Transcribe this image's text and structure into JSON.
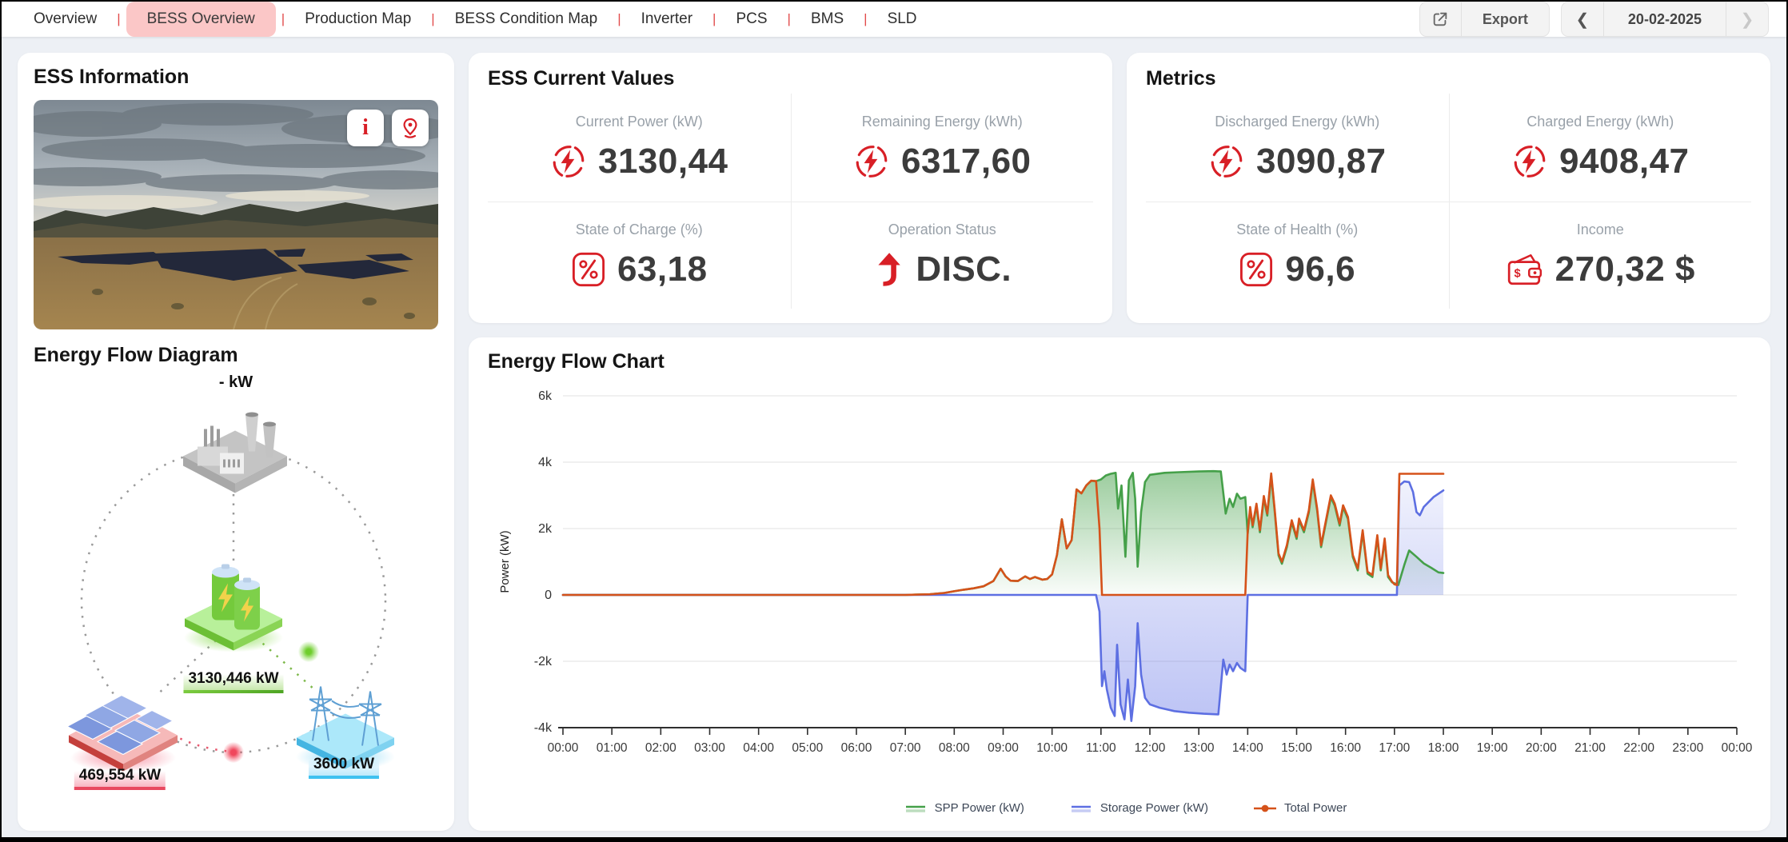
{
  "nav": {
    "tabs": [
      {
        "label": "Overview",
        "active": false
      },
      {
        "label": "BESS Overview",
        "active": true
      },
      {
        "label": "Production Map",
        "active": false
      },
      {
        "label": "BESS Condition Map",
        "active": false
      },
      {
        "label": "Inverter",
        "active": false
      },
      {
        "label": "PCS",
        "active": false
      },
      {
        "label": "BMS",
        "active": false
      },
      {
        "label": "SLD",
        "active": false
      }
    ],
    "separator": "|",
    "export_label": "Export",
    "date_value": "20-02-2025",
    "prev_icon": "chevron-left",
    "next_icon": "chevron-right"
  },
  "ess_information": {
    "title": "ESS Information",
    "photo_buttons": [
      {
        "name": "info"
      },
      {
        "name": "location"
      }
    ]
  },
  "energy_flow_diagram": {
    "title": "Energy Flow Diagram",
    "grid_power_label": "- kW",
    "battery_power_label": "3130,446 kW",
    "spp_power_label": "469,554 kW",
    "grid_export_label": "3600 kW"
  },
  "ess_current_values": {
    "title": "ESS Current Values",
    "stats": [
      {
        "label": "Current Power (kW)",
        "value": "3130,44",
        "icon": "bolt-circle"
      },
      {
        "label": "Remaining Energy (kWh)",
        "value": "6317,60",
        "icon": "bolt-circle"
      },
      {
        "label": "State of Charge (%)",
        "value": "63,18",
        "icon": "percent-box"
      },
      {
        "label": "Operation Status",
        "value": "DISC.",
        "icon": "discharge-arrow"
      }
    ]
  },
  "metrics": {
    "title": "Metrics",
    "stats": [
      {
        "label": "Discharged Energy (kWh)",
        "value": "3090,87",
        "icon": "bolt-circle"
      },
      {
        "label": "Charged Energy (kWh)",
        "value": "9408,47",
        "icon": "bolt-circle"
      },
      {
        "label": "State of Health (%)",
        "value": "96,6",
        "icon": "percent-box"
      },
      {
        "label": "Income",
        "value": "270,32 $",
        "icon": "wallet"
      }
    ]
  },
  "colors": {
    "accent_red": "#d81f26",
    "nav_active_pink": "#fbc7c7",
    "spp_green": "#45a049",
    "storage_blue": "#5d6fe2",
    "total_orange": "#d5521a",
    "grid_gray": "#e9e9e9",
    "page_bg": "#edf0f5"
  },
  "chart_data": {
    "type": "line",
    "title": "Energy Flow Chart",
    "ylabel": "Power (kW)",
    "xlabel": "",
    "ylim": [
      -4000,
      6000
    ],
    "yticks": [
      {
        "v": 6000,
        "label": "6k"
      },
      {
        "v": 4000,
        "label": "4k"
      },
      {
        "v": 2000,
        "label": "2k"
      },
      {
        "v": 0,
        "label": "0"
      },
      {
        "v": -2000,
        "label": "-2k"
      },
      {
        "v": -4000,
        "label": "-4k"
      }
    ],
    "x_hours": [
      0,
      24
    ],
    "xtick_labels": [
      "00:00",
      "01:00",
      "02:00",
      "03:00",
      "04:00",
      "05:00",
      "06:00",
      "07:00",
      "08:00",
      "09:00",
      "10:00",
      "11:00",
      "12:00",
      "13:00",
      "14:00",
      "15:00",
      "16:00",
      "17:00",
      "18:00",
      "19:00",
      "20:00",
      "21:00",
      "22:00",
      "23:00",
      "00:00"
    ],
    "grid": true,
    "legend_position": "bottom",
    "series": [
      {
        "name": "SPP Power (kW)",
        "color": "#45a049",
        "fill": "green",
        "points": [
          [
            0,
            0
          ],
          [
            5,
            0
          ],
          [
            7,
            0
          ],
          [
            7.5,
            20
          ],
          [
            7.8,
            60
          ],
          [
            8,
            110
          ],
          [
            8.2,
            160
          ],
          [
            8.4,
            200
          ],
          [
            8.6,
            260
          ],
          [
            8.8,
            420
          ],
          [
            8.95,
            790
          ],
          [
            9.05,
            560
          ],
          [
            9.15,
            430
          ],
          [
            9.3,
            420
          ],
          [
            9.45,
            560
          ],
          [
            9.55,
            480
          ],
          [
            9.65,
            540
          ],
          [
            9.8,
            460
          ],
          [
            9.9,
            480
          ],
          [
            10,
            620
          ],
          [
            10.1,
            1200
          ],
          [
            10.2,
            2280
          ],
          [
            10.3,
            1400
          ],
          [
            10.4,
            1650
          ],
          [
            10.5,
            3180
          ],
          [
            10.6,
            3060
          ],
          [
            10.7,
            3300
          ],
          [
            10.8,
            3440
          ],
          [
            10.9,
            3430
          ],
          [
            11,
            3480
          ],
          [
            11.1,
            3600
          ],
          [
            11.2,
            3650
          ],
          [
            11.3,
            3680
          ],
          [
            11.35,
            2600
          ],
          [
            11.42,
            3300
          ],
          [
            11.5,
            1150
          ],
          [
            11.57,
            3450
          ],
          [
            11.65,
            3680
          ],
          [
            11.7,
            2900
          ],
          [
            11.75,
            850
          ],
          [
            11.82,
            2500
          ],
          [
            11.9,
            3400
          ],
          [
            12,
            3620
          ],
          [
            12.3,
            3680
          ],
          [
            12.6,
            3700
          ],
          [
            13,
            3720
          ],
          [
            13.3,
            3730
          ],
          [
            13.45,
            3720
          ],
          [
            13.55,
            2450
          ],
          [
            13.63,
            2900
          ],
          [
            13.7,
            2650
          ],
          [
            13.78,
            3050
          ],
          [
            13.85,
            2900
          ],
          [
            13.95,
            2950
          ],
          [
            14,
            1840
          ],
          [
            14.05,
            2590
          ],
          [
            14.1,
            2040
          ],
          [
            14.18,
            2690
          ],
          [
            14.25,
            1890
          ],
          [
            14.33,
            2920
          ],
          [
            14.4,
            2390
          ],
          [
            14.48,
            3600
          ],
          [
            14.55,
            2540
          ],
          [
            14.63,
            1190
          ],
          [
            14.7,
            940
          ],
          [
            14.8,
            1440
          ],
          [
            14.9,
            2190
          ],
          [
            15,
            1690
          ],
          [
            15.05,
            2240
          ],
          [
            15.15,
            1890
          ],
          [
            15.25,
            2490
          ],
          [
            15.33,
            3420
          ],
          [
            15.42,
            2540
          ],
          [
            15.5,
            1440
          ],
          [
            15.6,
            2190
          ],
          [
            15.7,
            2940
          ],
          [
            15.78,
            2690
          ],
          [
            15.88,
            2090
          ],
          [
            15.95,
            2640
          ],
          [
            16.05,
            2290
          ],
          [
            16.15,
            1140
          ],
          [
            16.25,
            740
          ],
          [
            16.35,
            1890
          ],
          [
            16.45,
            640
          ],
          [
            16.55,
            540
          ],
          [
            16.65,
            1740
          ],
          [
            16.72,
            740
          ],
          [
            16.8,
            1640
          ],
          [
            16.87,
            540
          ],
          [
            16.95,
            380
          ],
          [
            17,
            350
          ],
          [
            17.08,
            300
          ],
          [
            17.2,
            900
          ],
          [
            17.3,
            1340
          ],
          [
            17.45,
            1150
          ],
          [
            17.6,
            950
          ],
          [
            17.75,
            820
          ],
          [
            17.9,
            680
          ],
          [
            18,
            660
          ]
        ]
      },
      {
        "name": "Storage Power (kW)",
        "color": "#5d6fe2",
        "fill": "blue",
        "points": [
          [
            0,
            0
          ],
          [
            5,
            0
          ],
          [
            9,
            0
          ],
          [
            10.9,
            0
          ],
          [
            10.97,
            -500
          ],
          [
            11.02,
            -2750
          ],
          [
            11.07,
            -2300
          ],
          [
            11.12,
            -2850
          ],
          [
            11.2,
            -3400
          ],
          [
            11.28,
            -3650
          ],
          [
            11.33,
            -1500
          ],
          [
            11.4,
            -3300
          ],
          [
            11.48,
            -3750
          ],
          [
            11.55,
            -2550
          ],
          [
            11.62,
            -3800
          ],
          [
            11.7,
            -2750
          ],
          [
            11.75,
            -850
          ],
          [
            11.82,
            -2400
          ],
          [
            11.9,
            -3100
          ],
          [
            11.95,
            -3200
          ],
          [
            12,
            -3300
          ],
          [
            12.2,
            -3400
          ],
          [
            12.5,
            -3500
          ],
          [
            12.8,
            -3550
          ],
          [
            13.1,
            -3580
          ],
          [
            13.4,
            -3600
          ],
          [
            13.5,
            -1950
          ],
          [
            13.57,
            -2400
          ],
          [
            13.63,
            -2100
          ],
          [
            13.7,
            -2300
          ],
          [
            13.78,
            -2050
          ],
          [
            13.85,
            -2200
          ],
          [
            13.95,
            -2300
          ],
          [
            14,
            0
          ],
          [
            15,
            0
          ],
          [
            16,
            0
          ],
          [
            17.05,
            0
          ],
          [
            17.1,
            3300
          ],
          [
            17.2,
            3420
          ],
          [
            17.3,
            3400
          ],
          [
            17.38,
            3100
          ],
          [
            17.45,
            2500
          ],
          [
            17.52,
            2400
          ],
          [
            17.6,
            2650
          ],
          [
            17.7,
            2800
          ],
          [
            17.8,
            2950
          ],
          [
            17.9,
            3050
          ],
          [
            18,
            3150
          ]
        ]
      },
      {
        "name": "Total Power",
        "color": "#d5521a",
        "fill": "none",
        "points": [
          [
            0,
            0
          ],
          [
            5,
            0
          ],
          [
            7,
            0
          ],
          [
            7.5,
            20
          ],
          [
            7.8,
            60
          ],
          [
            8,
            110
          ],
          [
            8.2,
            160
          ],
          [
            8.4,
            200
          ],
          [
            8.6,
            260
          ],
          [
            8.8,
            420
          ],
          [
            8.95,
            790
          ],
          [
            9.05,
            560
          ],
          [
            9.15,
            430
          ],
          [
            9.3,
            420
          ],
          [
            9.45,
            560
          ],
          [
            9.55,
            480
          ],
          [
            9.65,
            540
          ],
          [
            9.8,
            460
          ],
          [
            9.9,
            480
          ],
          [
            10,
            620
          ],
          [
            10.1,
            1200
          ],
          [
            10.2,
            2280
          ],
          [
            10.3,
            1400
          ],
          [
            10.4,
            1650
          ],
          [
            10.5,
            3180
          ],
          [
            10.6,
            3060
          ],
          [
            10.7,
            3300
          ],
          [
            10.8,
            3440
          ],
          [
            10.9,
            3430
          ],
          [
            10.97,
            2000
          ],
          [
            11.02,
            0
          ],
          [
            12,
            0
          ],
          [
            13,
            0
          ],
          [
            13.95,
            0
          ],
          [
            14,
            1900
          ],
          [
            14.05,
            2650
          ],
          [
            14.1,
            2100
          ],
          [
            14.18,
            2750
          ],
          [
            14.25,
            1950
          ],
          [
            14.33,
            2980
          ],
          [
            14.4,
            2450
          ],
          [
            14.48,
            3660
          ],
          [
            14.55,
            2600
          ],
          [
            14.63,
            1250
          ],
          [
            14.7,
            1000
          ],
          [
            14.8,
            1500
          ],
          [
            14.9,
            2250
          ],
          [
            15,
            1750
          ],
          [
            15.05,
            2300
          ],
          [
            15.15,
            1950
          ],
          [
            15.25,
            2550
          ],
          [
            15.33,
            3480
          ],
          [
            15.42,
            2600
          ],
          [
            15.5,
            1500
          ],
          [
            15.6,
            2250
          ],
          [
            15.7,
            3000
          ],
          [
            15.78,
            2750
          ],
          [
            15.88,
            2150
          ],
          [
            15.95,
            2700
          ],
          [
            16.05,
            2350
          ],
          [
            16.15,
            1200
          ],
          [
            16.25,
            800
          ],
          [
            16.35,
            1950
          ],
          [
            16.45,
            700
          ],
          [
            16.55,
            600
          ],
          [
            16.65,
            1800
          ],
          [
            16.72,
            800
          ],
          [
            16.8,
            1700
          ],
          [
            16.87,
            600
          ],
          [
            16.95,
            400
          ],
          [
            17,
            320
          ],
          [
            17.05,
            300
          ],
          [
            17.1,
            3650
          ],
          [
            18,
            3650
          ]
        ]
      }
    ]
  }
}
